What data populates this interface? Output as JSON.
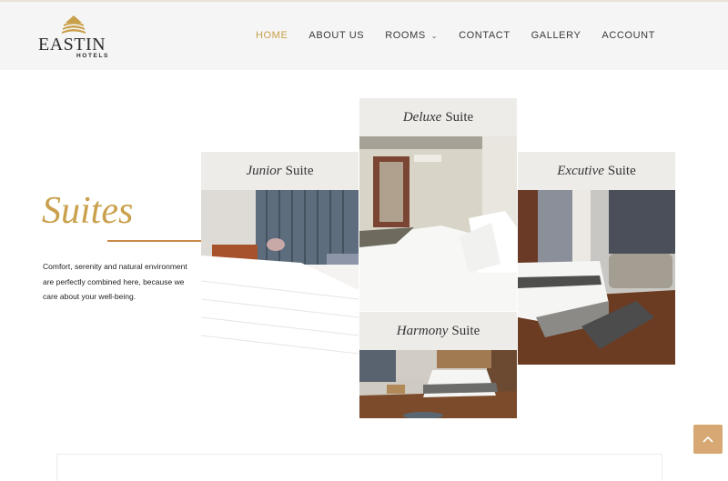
{
  "brand": {
    "name": "EASTIN",
    "subtitle": "HOTELS"
  },
  "nav": {
    "items": [
      {
        "label": "HOME",
        "active": true
      },
      {
        "label": "ABOUT US",
        "active": false
      },
      {
        "label": "ROOMS",
        "active": false,
        "has_dropdown": true
      },
      {
        "label": "CONTACT",
        "active": false
      },
      {
        "label": "GALLERY",
        "active": false
      },
      {
        "label": "ACCOUNT",
        "active": false
      }
    ]
  },
  "intro": {
    "title": "Suites",
    "description": "Comfort, serenity and natural environment are perfectly combined here, because we care about your well-being."
  },
  "suites": [
    {
      "emphasis": "Junior",
      "label": "Suite"
    },
    {
      "emphasis": "Deluxe",
      "label": "Suite"
    },
    {
      "emphasis": "Excutive",
      "label": "Suite"
    },
    {
      "emphasis": "Harmony",
      "label": "Suite"
    }
  ],
  "colors": {
    "accent": "#c9a04c",
    "rule": "#c98a4a",
    "back_to_top": "#d7a874"
  },
  "icons": {
    "dropdown": "chevron-down-icon",
    "back_to_top": "arrow-up-icon"
  }
}
